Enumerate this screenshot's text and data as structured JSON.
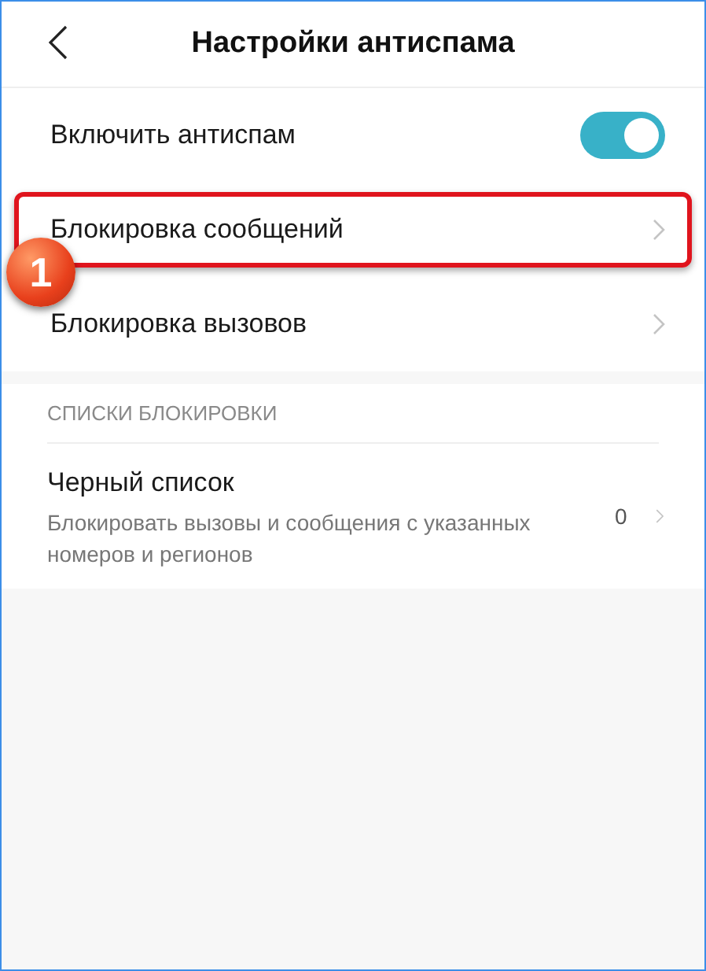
{
  "header": {
    "title": "Настройки антиспама"
  },
  "settings": [
    {
      "kind": "toggle",
      "label": "Включить антиспам",
      "on": true,
      "highlighted": false
    },
    {
      "kind": "link",
      "label": "Блокировка сообщений",
      "highlighted": true
    },
    {
      "kind": "link",
      "label": "Блокировка вызовов",
      "highlighted": false
    }
  ],
  "blocklists": {
    "heading": "СПИСКИ БЛОКИРОВКИ",
    "items": [
      {
        "title": "Черный список",
        "description": "Блокировать вызовы и сообщения с указанных номеров и регионов",
        "count": "0"
      }
    ]
  },
  "annotation": {
    "badge": "1"
  }
}
